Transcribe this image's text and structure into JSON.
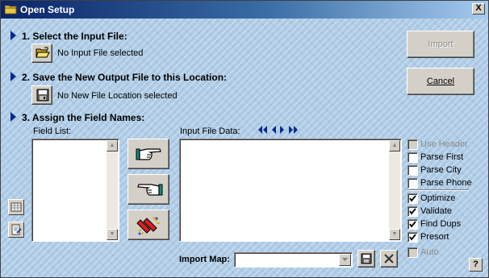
{
  "window": {
    "title": "Open Setup",
    "close_label": "X"
  },
  "steps": {
    "step1": {
      "title": "1. Select the Input File:",
      "status": "No Input File selected"
    },
    "step2": {
      "title": "2. Save the New Output File to this Location:",
      "status": "No New File Location selected"
    },
    "step3": {
      "title": "3. Assign the Field Names:"
    }
  },
  "buttons": {
    "import": "Import",
    "cancel": "Cancel"
  },
  "field_list": {
    "label": "Field List:"
  },
  "input_data": {
    "label": "Input File Data:"
  },
  "options": [
    {
      "label": "Use Header",
      "checked": false,
      "enabled": false
    },
    {
      "label": "Parse First",
      "checked": false,
      "enabled": true
    },
    {
      "label": "Parse City",
      "checked": false,
      "enabled": true
    },
    {
      "label": "Parse Phone",
      "checked": false,
      "enabled": true
    },
    {
      "label": "Optimize",
      "checked": true,
      "enabled": true
    },
    {
      "label": "Validate",
      "checked": true,
      "enabled": true
    },
    {
      "label": "Find Dups",
      "checked": true,
      "enabled": true
    },
    {
      "label": "Presort",
      "checked": true,
      "enabled": true
    },
    {
      "label": "Auto",
      "checked": false,
      "enabled": false
    }
  ],
  "import_map": {
    "label": "Import Map:",
    "value": ""
  },
  "help": {
    "label": "?"
  },
  "colors": {
    "accent_arrow": "#0a2a8a",
    "background": "#aecbe6",
    "titlebar": "#0a246a"
  },
  "icons": {
    "open_folder": "open-folder-icon",
    "save_disk": "floppy-disk-icon",
    "hand_right": "hand-pointing-right-icon",
    "hand_left": "hand-pointing-left-icon",
    "clear": "eraser-sparkle-icon",
    "nav": [
      "first-record-icon",
      "prev-record-icon",
      "next-record-icon",
      "last-record-icon"
    ]
  }
}
